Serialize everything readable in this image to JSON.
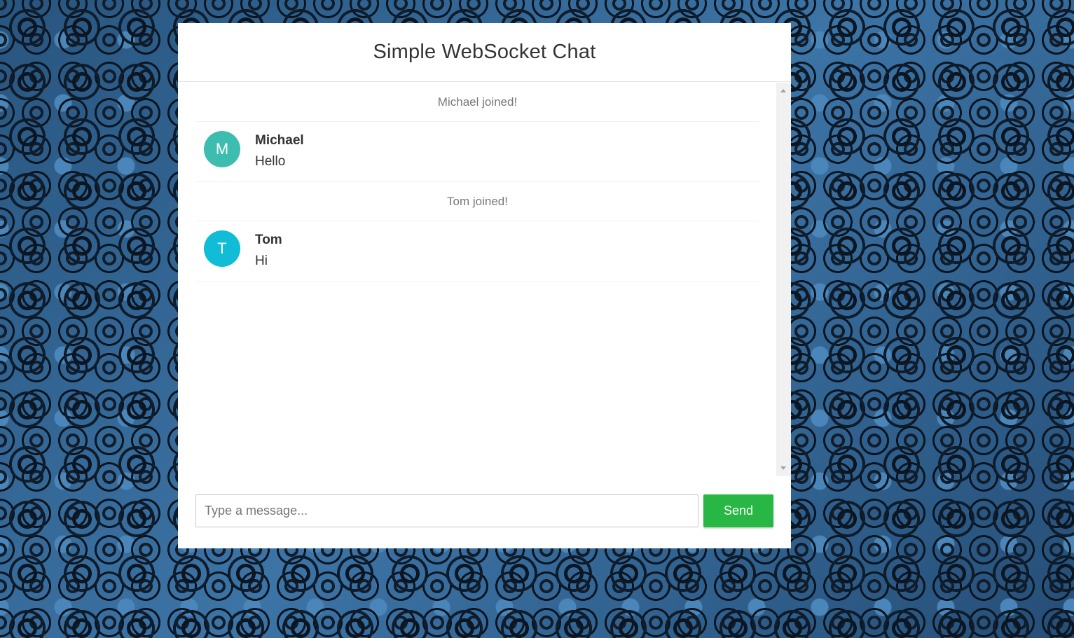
{
  "header": {
    "title": "Simple WebSocket Chat"
  },
  "messages": [
    {
      "type": "event",
      "text": "Michael joined!"
    },
    {
      "type": "chat",
      "avatar_letter": "M",
      "avatar_color": "#3dbdb0",
      "sender": "Michael",
      "text": "Hello"
    },
    {
      "type": "event",
      "text": "Tom joined!"
    },
    {
      "type": "chat",
      "avatar_letter": "T",
      "avatar_color": "#10bcd6",
      "sender": "Tom",
      "text": "Hi"
    }
  ],
  "composer": {
    "placeholder": "Type a message...",
    "value": "",
    "send_label": "Send"
  },
  "colors": {
    "send_button": "#28b744",
    "background": "#2f6191"
  }
}
